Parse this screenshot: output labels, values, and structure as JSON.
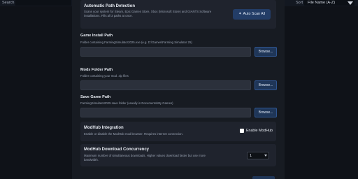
{
  "topbar": {
    "search_label": "Search",
    "sort_label": "Sort",
    "sort_value": "File Name (A-Z)"
  },
  "auto_detect": {
    "title": "Automatic Path Detection",
    "desc_line1": "Scans your system for Steam, Epic Games Store, Xbox (Microsoft Store) and GIANTS Software",
    "desc_line2": "installations. Fills all 3 paths at once.",
    "button_label": "Auto Scan All",
    "button_icon": "magic-wand-icon"
  },
  "game_install": {
    "title": "Game Install Path",
    "desc": "Folder containing FarmingSimulator2025.exe (e.g. D:\\Games\\Farming Simulator 25)",
    "value": "",
    "browse_label": "Browse..."
  },
  "mods_folder": {
    "title": "Mods Folder Path",
    "desc": "Folder containing your mod .zip files",
    "value": "",
    "browse_label": "Browse..."
  },
  "save_game": {
    "title": "Save Game Path",
    "desc": "FarmingSimulator2025 save folder (usually in Documents\\My Games)",
    "value": "",
    "browse_label": "Browse..."
  },
  "modhub_integration": {
    "title": "ModHub Integration",
    "desc": "Enable or disable the ModHub mod browser. Requires internet connection.",
    "checkbox_label": "Enable ModHub",
    "checked": false
  },
  "modhub_concurrency": {
    "title": "ModHub Download Concurrency",
    "desc_line1": "Maximum number of simultaneous downloads. Higher values download faster but use more",
    "desc_line2": "bandwidth.",
    "selected_value": "1"
  },
  "colors": {
    "accent": "#233d67",
    "background": "#0f1218",
    "panel": "#171b22",
    "card": "#1f232d"
  }
}
